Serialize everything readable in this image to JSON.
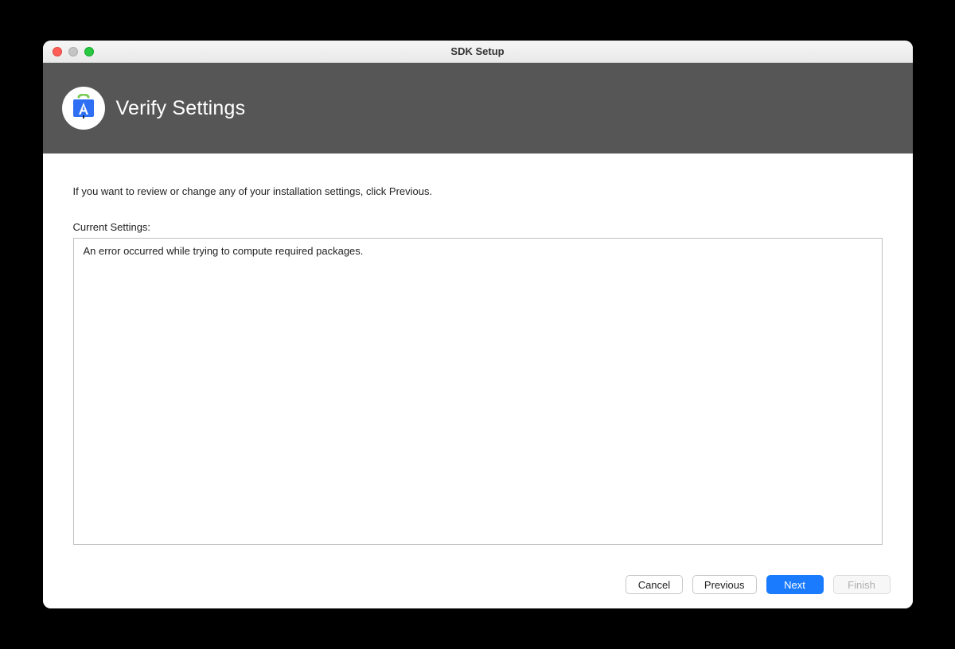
{
  "window": {
    "title": "SDK Setup"
  },
  "header": {
    "page_title": "Verify Settings"
  },
  "content": {
    "intro": "If you want to review or change any of your installation settings, click Previous.",
    "settings_label": "Current Settings:",
    "settings_body": "An error occurred while trying to compute required packages."
  },
  "footer": {
    "cancel": "Cancel",
    "previous": "Previous",
    "next": "Next",
    "finish": "Finish"
  }
}
